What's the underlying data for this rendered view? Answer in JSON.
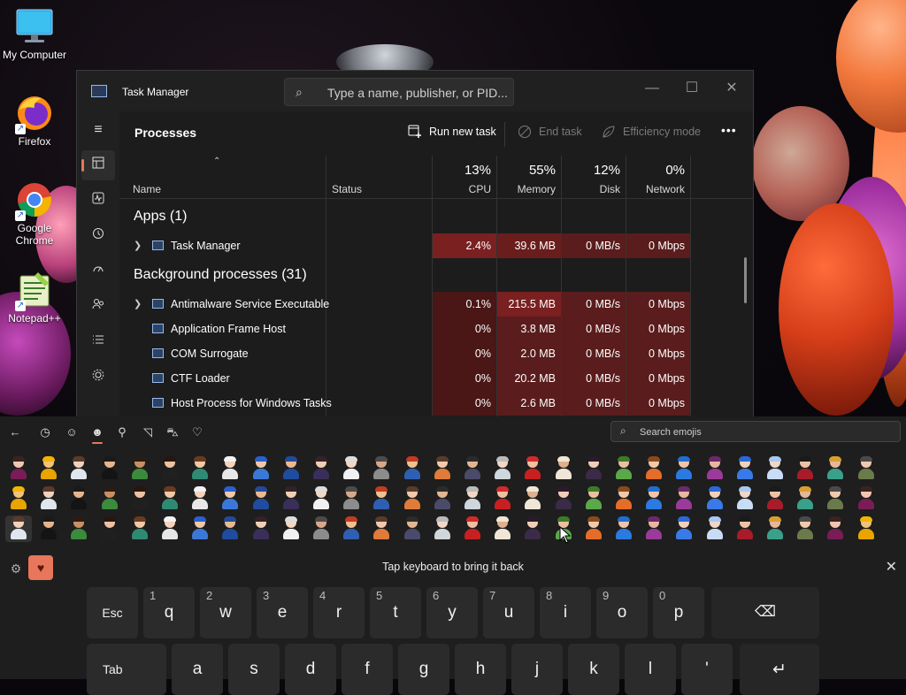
{
  "desktop": {
    "icons": [
      {
        "label": "My Computer"
      },
      {
        "label": "Firefox"
      },
      {
        "label": "Google Chrome"
      },
      {
        "label": "Notepad++"
      }
    ]
  },
  "task_manager": {
    "title": "Task Manager",
    "search_placeholder": "Type a name, publisher, or PID...",
    "window_buttons": {
      "minimize": "—",
      "maximize": "☐",
      "close": "✕"
    },
    "page_title": "Processes",
    "toolbar": {
      "run_new_task": "Run new task",
      "end_task": "End task",
      "efficiency_mode": "Efficiency mode",
      "more": "•••"
    },
    "nav_icons": [
      "hamburger-icon",
      "processes-icon",
      "performance-icon",
      "app-history-icon",
      "startup-apps-icon",
      "users-icon",
      "details-icon",
      "services-icon"
    ],
    "columns": {
      "name": "Name",
      "status": "Status",
      "cpu": {
        "pct": "13%",
        "label": "CPU"
      },
      "memory": {
        "pct": "55%",
        "label": "Memory"
      },
      "disk": {
        "pct": "12%",
        "label": "Disk"
      },
      "network": {
        "pct": "0%",
        "label": "Network"
      }
    },
    "groups": {
      "apps": "Apps (1)",
      "background": "Background processes (31)"
    },
    "apps_rows": [
      {
        "name": "Task Manager",
        "cpu": "2.4%",
        "memory": "39.6 MB",
        "disk": "0 MB/s",
        "network": "0 Mbps"
      }
    ],
    "background_rows": [
      {
        "name": "Antimalware Service Executable",
        "cpu": "0.1%",
        "memory": "215.5 MB",
        "disk": "0 MB/s",
        "network": "0 Mbps"
      },
      {
        "name": "Application Frame Host",
        "cpu": "0%",
        "memory": "3.8 MB",
        "disk": "0 MB/s",
        "network": "0 Mbps"
      },
      {
        "name": "COM Surrogate",
        "cpu": "0%",
        "memory": "2.0 MB",
        "disk": "0 MB/s",
        "network": "0 Mbps"
      },
      {
        "name": "CTF Loader",
        "cpu": "0%",
        "memory": "20.2 MB",
        "disk": "0 MB/s",
        "network": "0 Mbps"
      },
      {
        "name": "Host Process for Windows Tasks",
        "cpu": "0%",
        "memory": "2.6 MB",
        "disk": "0 MB/s",
        "network": "0 Mbps"
      }
    ]
  },
  "emoji_panel": {
    "search_placeholder": "Search emojis",
    "hint": "Tap keyboard to bring it back",
    "tabs": [
      "back-arrow-icon",
      "recent-icon",
      "smiley-icon",
      "people-icon",
      "balloon-icon",
      "food-icon",
      "car-icon",
      "heart-icon"
    ],
    "people_colors": [
      {
        "skin": "#f3c6b0",
        "hair": "#3a2320",
        "outfit": "#7a1c56"
      },
      {
        "skin": "#f1c27d",
        "hair": "#f4b400",
        "outfit": "#e9a400"
      },
      {
        "skin": "#f3d2bd",
        "hair": "#5a3a2a",
        "outfit": "#dfe6ee"
      },
      {
        "skin": "#e8b48e",
        "hair": "#1a1a1a",
        "outfit": "#141414"
      },
      {
        "skin": "#c98f64",
        "hair": "#2b1b14",
        "outfit": "#3c8a3c"
      },
      {
        "skin": "#f0c1a0",
        "hair": "#26160f",
        "outfit": "#202020"
      },
      {
        "skin": "#f1c9a5",
        "hair": "#6a3b1f",
        "outfit": "#2e8a73"
      },
      {
        "skin": "#f5d3bb",
        "hair": "#f2f2f2",
        "outfit": "#e8e8e8"
      },
      {
        "skin": "#f0c8a8",
        "hair": "#2a5fd0",
        "outfit": "#3a78d8"
      },
      {
        "skin": "#e9b990",
        "hair": "#234a9a",
        "outfit": "#1f4c9e"
      },
      {
        "skin": "#f1cfb3",
        "hair": "#33222a",
        "outfit": "#3a2e5a"
      },
      {
        "skin": "#f3d7c3",
        "hair": "#dddddd",
        "outfit": "#f1f1f1"
      },
      {
        "skin": "#d8a78a",
        "hair": "#4b4b4b",
        "outfit": "#8c8c8c"
      },
      {
        "skin": "#f0c090",
        "hair": "#c23b22",
        "outfit": "#2f5fb3"
      },
      {
        "skin": "#f2c9ad",
        "hair": "#5a3a2a",
        "outfit": "#e07b3a"
      },
      {
        "skin": "#e4b690",
        "hair": "#2b2b2b",
        "outfit": "#4a4a6a"
      },
      {
        "skin": "#f3d7c6",
        "hair": "#bbbbbb",
        "outfit": "#cfd7dd"
      },
      {
        "skin": "#f0c0a0",
        "hair": "#d02a2a",
        "outfit": "#c82020"
      },
      {
        "skin": "#e0b08c",
        "hair": "#f0e6d6",
        "outfit": "#efe6d8"
      },
      {
        "skin": "#f2cdb8",
        "hair": "#2a1a2a",
        "outfit": "#3b2a48"
      },
      {
        "skin": "#eac0a0",
        "hair": "#3d7a2a",
        "outfit": "#5ba84a"
      },
      {
        "skin": "#f1c9ad",
        "hair": "#8a4a1a",
        "outfit": "#e56d2a"
      },
      {
        "skin": "#f0c4a8",
        "hair": "#1f6fd0",
        "outfit": "#2a7ae0"
      },
      {
        "skin": "#e8b7a0",
        "hair": "#6a2a6a",
        "outfit": "#9a3a9a"
      },
      {
        "skin": "#f3d0b8",
        "hair": "#2a6ad8",
        "outfit": "#3a7ae8"
      },
      {
        "skin": "#f0d6c8",
        "hair": "#a8c8f0",
        "outfit": "#c8dcf6"
      },
      {
        "skin": "#ecc2a6",
        "hair": "#1a1a1a",
        "outfit": "#a81c2a"
      },
      {
        "skin": "#e6b898",
        "hair": "#d8a030",
        "outfit": "#3aa08a"
      },
      {
        "skin": "#f1c9ad",
        "hair": "#4a4a4a",
        "outfit": "#6a7a4a"
      }
    ]
  },
  "keyboard": {
    "row1": [
      {
        "main": "Esc",
        "sub": ""
      },
      {
        "main": "q",
        "sub": "1"
      },
      {
        "main": "w",
        "sub": "2"
      },
      {
        "main": "e",
        "sub": "3"
      },
      {
        "main": "r",
        "sub": "4"
      },
      {
        "main": "t",
        "sub": "5"
      },
      {
        "main": "y",
        "sub": "6"
      },
      {
        "main": "u",
        "sub": "7"
      },
      {
        "main": "i",
        "sub": "8"
      },
      {
        "main": "o",
        "sub": "9"
      },
      {
        "main": "p",
        "sub": "0"
      },
      {
        "main": "⌫",
        "sub": ""
      }
    ],
    "row2": [
      {
        "main": "Tab",
        "sub": ""
      },
      {
        "main": "a",
        "sub": ""
      },
      {
        "main": "s",
        "sub": ""
      },
      {
        "main": "d",
        "sub": ""
      },
      {
        "main": "f",
        "sub": ""
      },
      {
        "main": "g",
        "sub": ""
      },
      {
        "main": "h",
        "sub": ""
      },
      {
        "main": "j",
        "sub": ""
      },
      {
        "main": "k",
        "sub": ""
      },
      {
        "main": "l",
        "sub": ""
      },
      {
        "main": "'",
        "sub": ""
      },
      {
        "main": "↵",
        "sub": ""
      }
    ]
  },
  "colors": {
    "accent": "#e8765a",
    "heat_low": "#4a1616",
    "heat_high": "#7a2020"
  }
}
